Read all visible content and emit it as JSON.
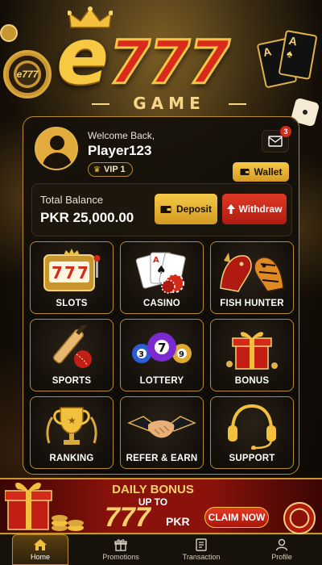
{
  "logo": {
    "brand_letter": "e",
    "brand_number": "777",
    "brand_word": "GAME",
    "chip_text": "e777"
  },
  "profile": {
    "welcome": "Welcome Back,",
    "username": "Player123",
    "vip_label": "VIP 1",
    "mail_count": "3",
    "wallet_label": "Wallet"
  },
  "balance": {
    "label": "Total Balance",
    "value": "PKR 25,000.00",
    "deposit_label": "Deposit",
    "withdraw_label": "Withdraw"
  },
  "games": [
    {
      "label": "SLOTS",
      "icon": "slot-machine-icon"
    },
    {
      "label": "CASINO",
      "icon": "playing-cards-icon"
    },
    {
      "label": "FISH HUNTER",
      "icon": "dragon-tiger-icon"
    },
    {
      "label": "SPORTS",
      "icon": "cricket-icon"
    },
    {
      "label": "LOTTERY",
      "icon": "lottery-balls-icon"
    },
    {
      "label": "BONUS",
      "icon": "gift-box-icon"
    },
    {
      "label": "RANKING",
      "icon": "trophy-icon"
    },
    {
      "label": "REFER & EARN",
      "icon": "handshake-icon"
    },
    {
      "label": "SUPPORT",
      "icon": "headset-icon"
    }
  ],
  "bonus": {
    "title": "DAILY BONUS",
    "up_to": "UP TO",
    "amount": "777",
    "currency": "PKR",
    "claim_label": "CLAIM NOW"
  },
  "nav": [
    {
      "label": "Home",
      "icon": "home-icon",
      "active": true
    },
    {
      "label": "Promotions",
      "icon": "gift-icon",
      "active": false
    },
    {
      "label": "Transaction",
      "icon": "receipt-icon",
      "active": false
    },
    {
      "label": "Profile",
      "icon": "user-icon",
      "active": false
    }
  ],
  "colors": {
    "gold": "#e0b34a",
    "red": "#d42a1a",
    "background": "#0b0805"
  }
}
